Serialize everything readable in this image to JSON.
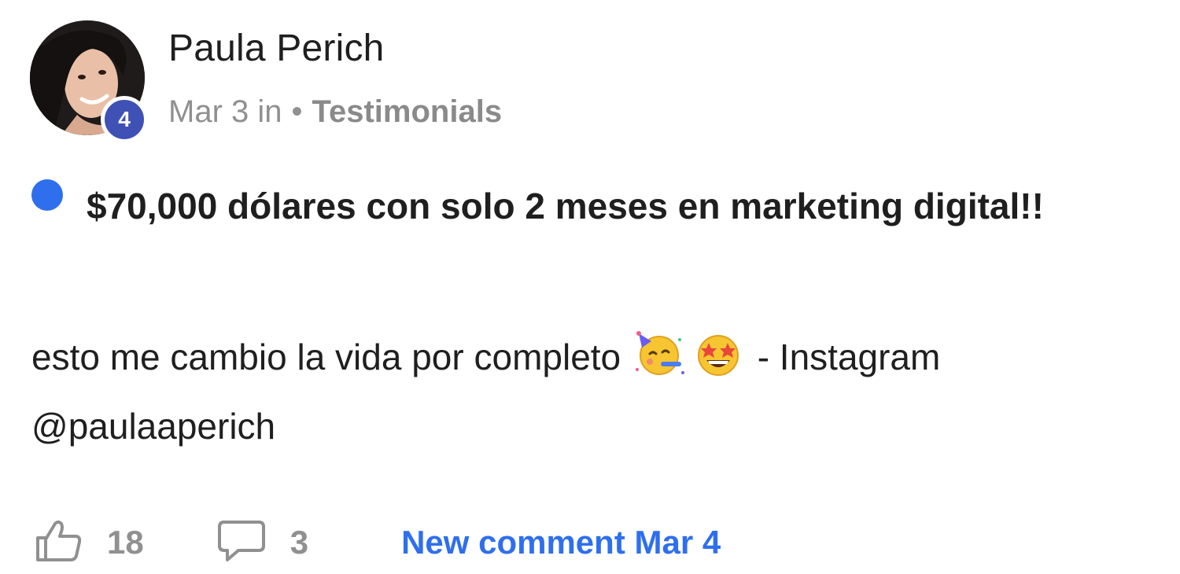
{
  "post": {
    "author": {
      "name": "Paula Perich",
      "level": "4"
    },
    "meta": {
      "date": "Mar 3 in",
      "separator": "•",
      "category": "Testimonials"
    },
    "title": "$70,000 dólares con solo 2 meses en marketing digital!!",
    "body": {
      "text_before": "esto me cambio la vida por completo",
      "emojis": [
        "partying-face-emoji",
        "star-struck-emoji"
      ],
      "text_after": "- Instagram @paulaaperich"
    },
    "footer": {
      "likes": "18",
      "comments": "3",
      "new_comment": "New comment Mar 4"
    },
    "colors": {
      "accent": "#2f6fed",
      "level_badge": "#3f51b5",
      "muted": "#909090"
    }
  }
}
